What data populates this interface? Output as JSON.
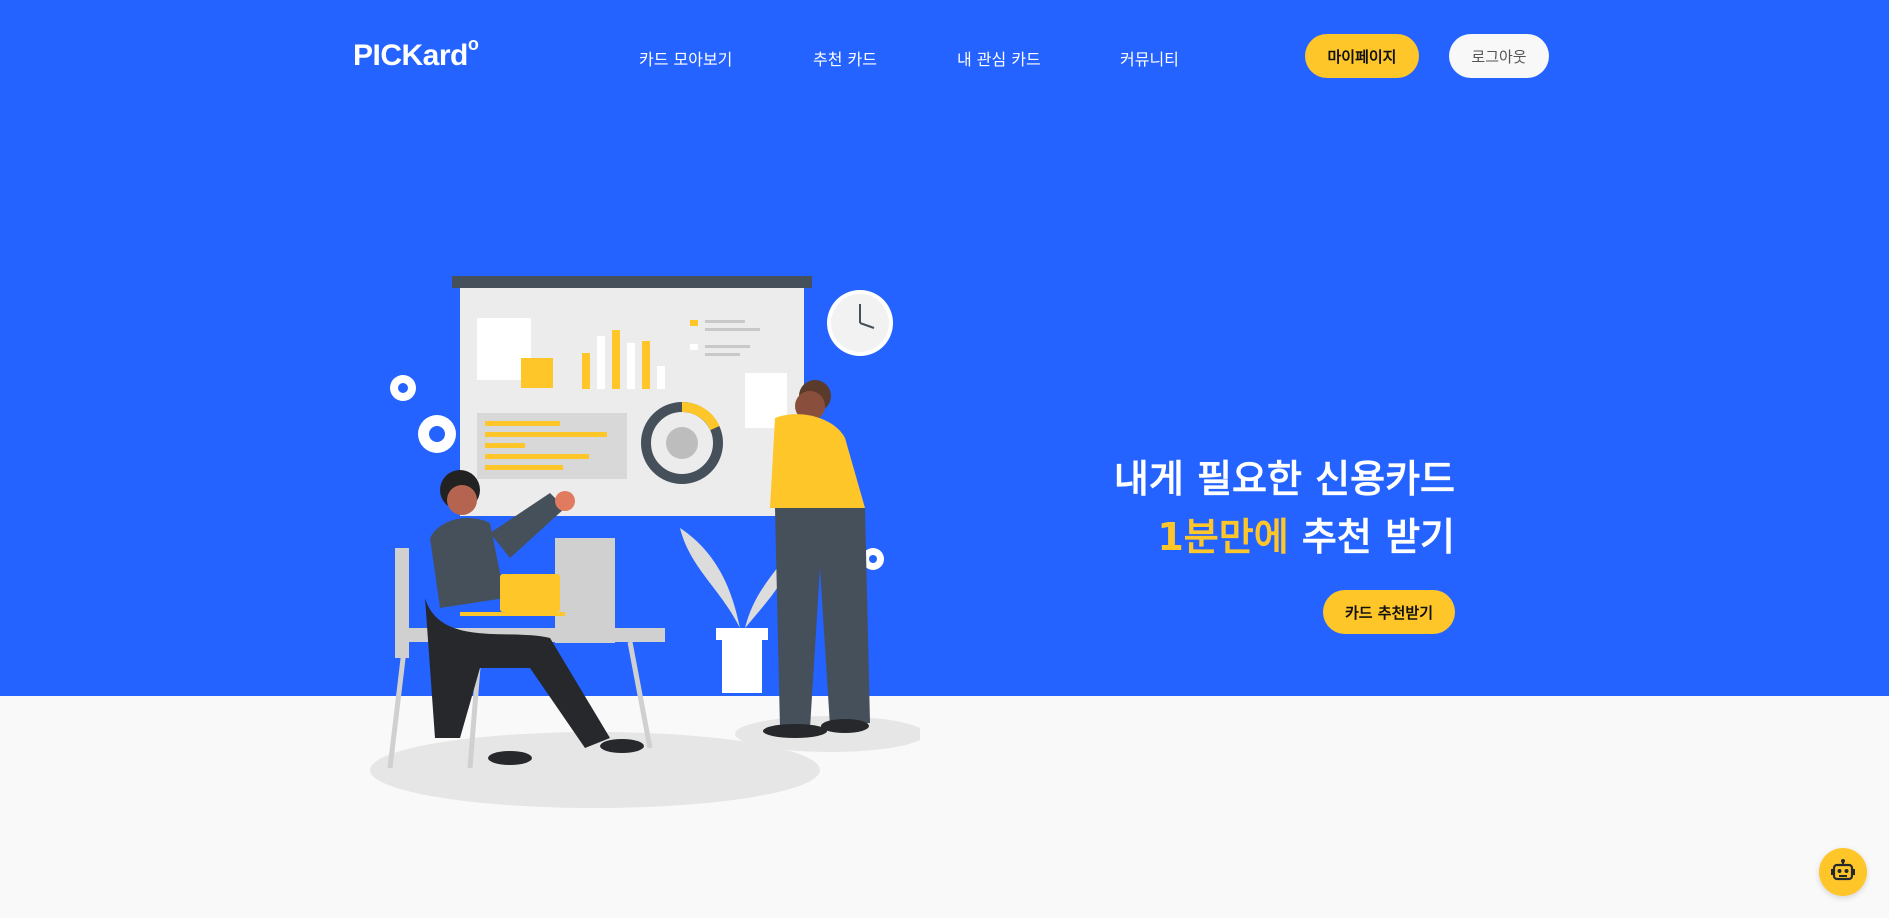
{
  "header": {
    "logo_text": "PICKard",
    "logo_mark": "o",
    "nav": [
      "카드 모아보기",
      "추천 카드",
      "내 관심 카드",
      "커뮤니티"
    ],
    "mypage_label": "마이페이지",
    "logout_label": "로그아웃"
  },
  "hero": {
    "headline_line1": "내게 필요한 신용카드",
    "headline_accent": "1분만에",
    "headline_line2_rest": " 추천 받기",
    "cta_label": "카드 추천받기",
    "illustration": "presentation-meeting-illustration"
  },
  "floating": {
    "chatbot_icon": "robot-icon"
  },
  "colors": {
    "primary_blue": "#2463ff",
    "accent_yellow": "#ffc629",
    "background": "#f9f9f9",
    "dark_gray": "#46505a"
  }
}
